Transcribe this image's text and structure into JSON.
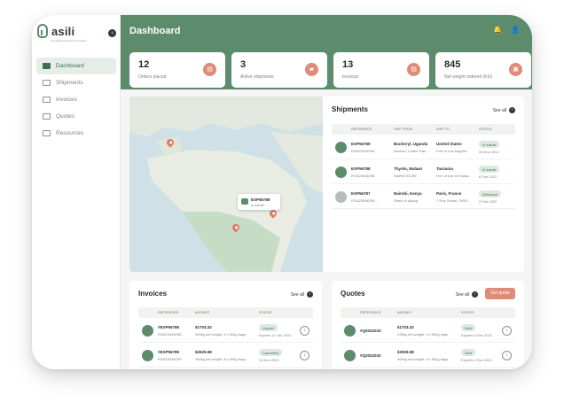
{
  "app": {
    "name": "asili",
    "tagline": "connecting farmers to markets"
  },
  "sidebar": {
    "items": [
      {
        "label": "Dashboard",
        "icon": "home-icon",
        "active": true
      },
      {
        "label": "Shipments",
        "icon": "truck-icon",
        "active": false
      },
      {
        "label": "Invoices",
        "icon": "invoice-icon",
        "active": false
      },
      {
        "label": "Quotes",
        "icon": "quote-icon",
        "active": false
      },
      {
        "label": "Resources",
        "icon": "folder-icon",
        "active": false
      }
    ]
  },
  "header": {
    "title": "Dashboard"
  },
  "stats": [
    {
      "value": "12",
      "label": "Orders placed"
    },
    {
      "value": "3",
      "label": "Active shipments"
    },
    {
      "value": "13",
      "label": "Invoices"
    },
    {
      "value": "845",
      "label": "Net weight ordered (KG)"
    }
  ],
  "map": {
    "popup_ref": "EXP56789",
    "popup_status": "In transit"
  },
  "shipments": {
    "title": "Shipments",
    "see_all": "See all",
    "columns": [
      "REFERENCE",
      "SHIP FROM",
      "SHIP TO",
      "STATUS"
    ],
    "rows": [
      {
        "ref": "EXP56789",
        "sub": "ROA23456789",
        "from": "Bucheryl, Uganda",
        "from_sub": "Ashineo Coffee Plan...",
        "to": "United States",
        "to_sub": "Port of Los Angeles",
        "status": "In transit",
        "date": "20 Nov 2022"
      },
      {
        "ref": "EXP56788",
        "sub": "ROA23456788",
        "from": "Thyolo, Malawi",
        "from_sub": "WAREHOUSE",
        "to": "Tanzania",
        "to_sub": "Port of Dar es Salaa...",
        "status": "In transit",
        "date": "6 Feb 2022"
      },
      {
        "ref": "EXP56787",
        "sub": "ROA23456789...",
        "from": "Nairobi, Kenya",
        "from_sub": "Place of pickup",
        "to": "Paris, France",
        "to_sub": "7 Rue Seirial, 75011",
        "status": "Delivered",
        "date": "2 Feb 2022"
      }
    ]
  },
  "invoices": {
    "title": "Invoices",
    "see_all": "See all",
    "columns": [
      "REFERENCE",
      "AMOUNT",
      "STATUS"
    ],
    "rows": [
      {
        "ref": "#EXP56786",
        "sub": "ROA23456788",
        "amount": "$1703.32",
        "detail": "300kg net weight, 4 x 50kg bags",
        "status": "Unpaid",
        "date": "Expires 12 Jan 2022"
      },
      {
        "ref": "#EXP56785",
        "sub": "ROA23456789",
        "amount": "$2929.58",
        "detail": "400kg net weight, 8 x 50kg bags",
        "status": "Cancelled",
        "date": "24 Nov 2021"
      }
    ]
  },
  "quotes": {
    "title": "Quotes",
    "see_all": "See all",
    "get_quote": "Get quote",
    "columns": [
      "REFERENCE",
      "AMOUNT",
      "STATUS"
    ],
    "rows": [
      {
        "ref": "#Q2022033",
        "amount": "$1703.32",
        "detail": "235kg net weight, 4 x 50kg bags",
        "status": "Sent",
        "date": "Expires 6 Dec 2021"
      },
      {
        "ref": "#Q2022032",
        "amount": "$2929.58",
        "detail": "400kg net weight, 8 x 50kg bags",
        "status": "Sent",
        "date": "Expires 4 Dec 2021"
      }
    ]
  },
  "colors": {
    "brand": "#5c8c6b",
    "accent": "#e08b78"
  }
}
